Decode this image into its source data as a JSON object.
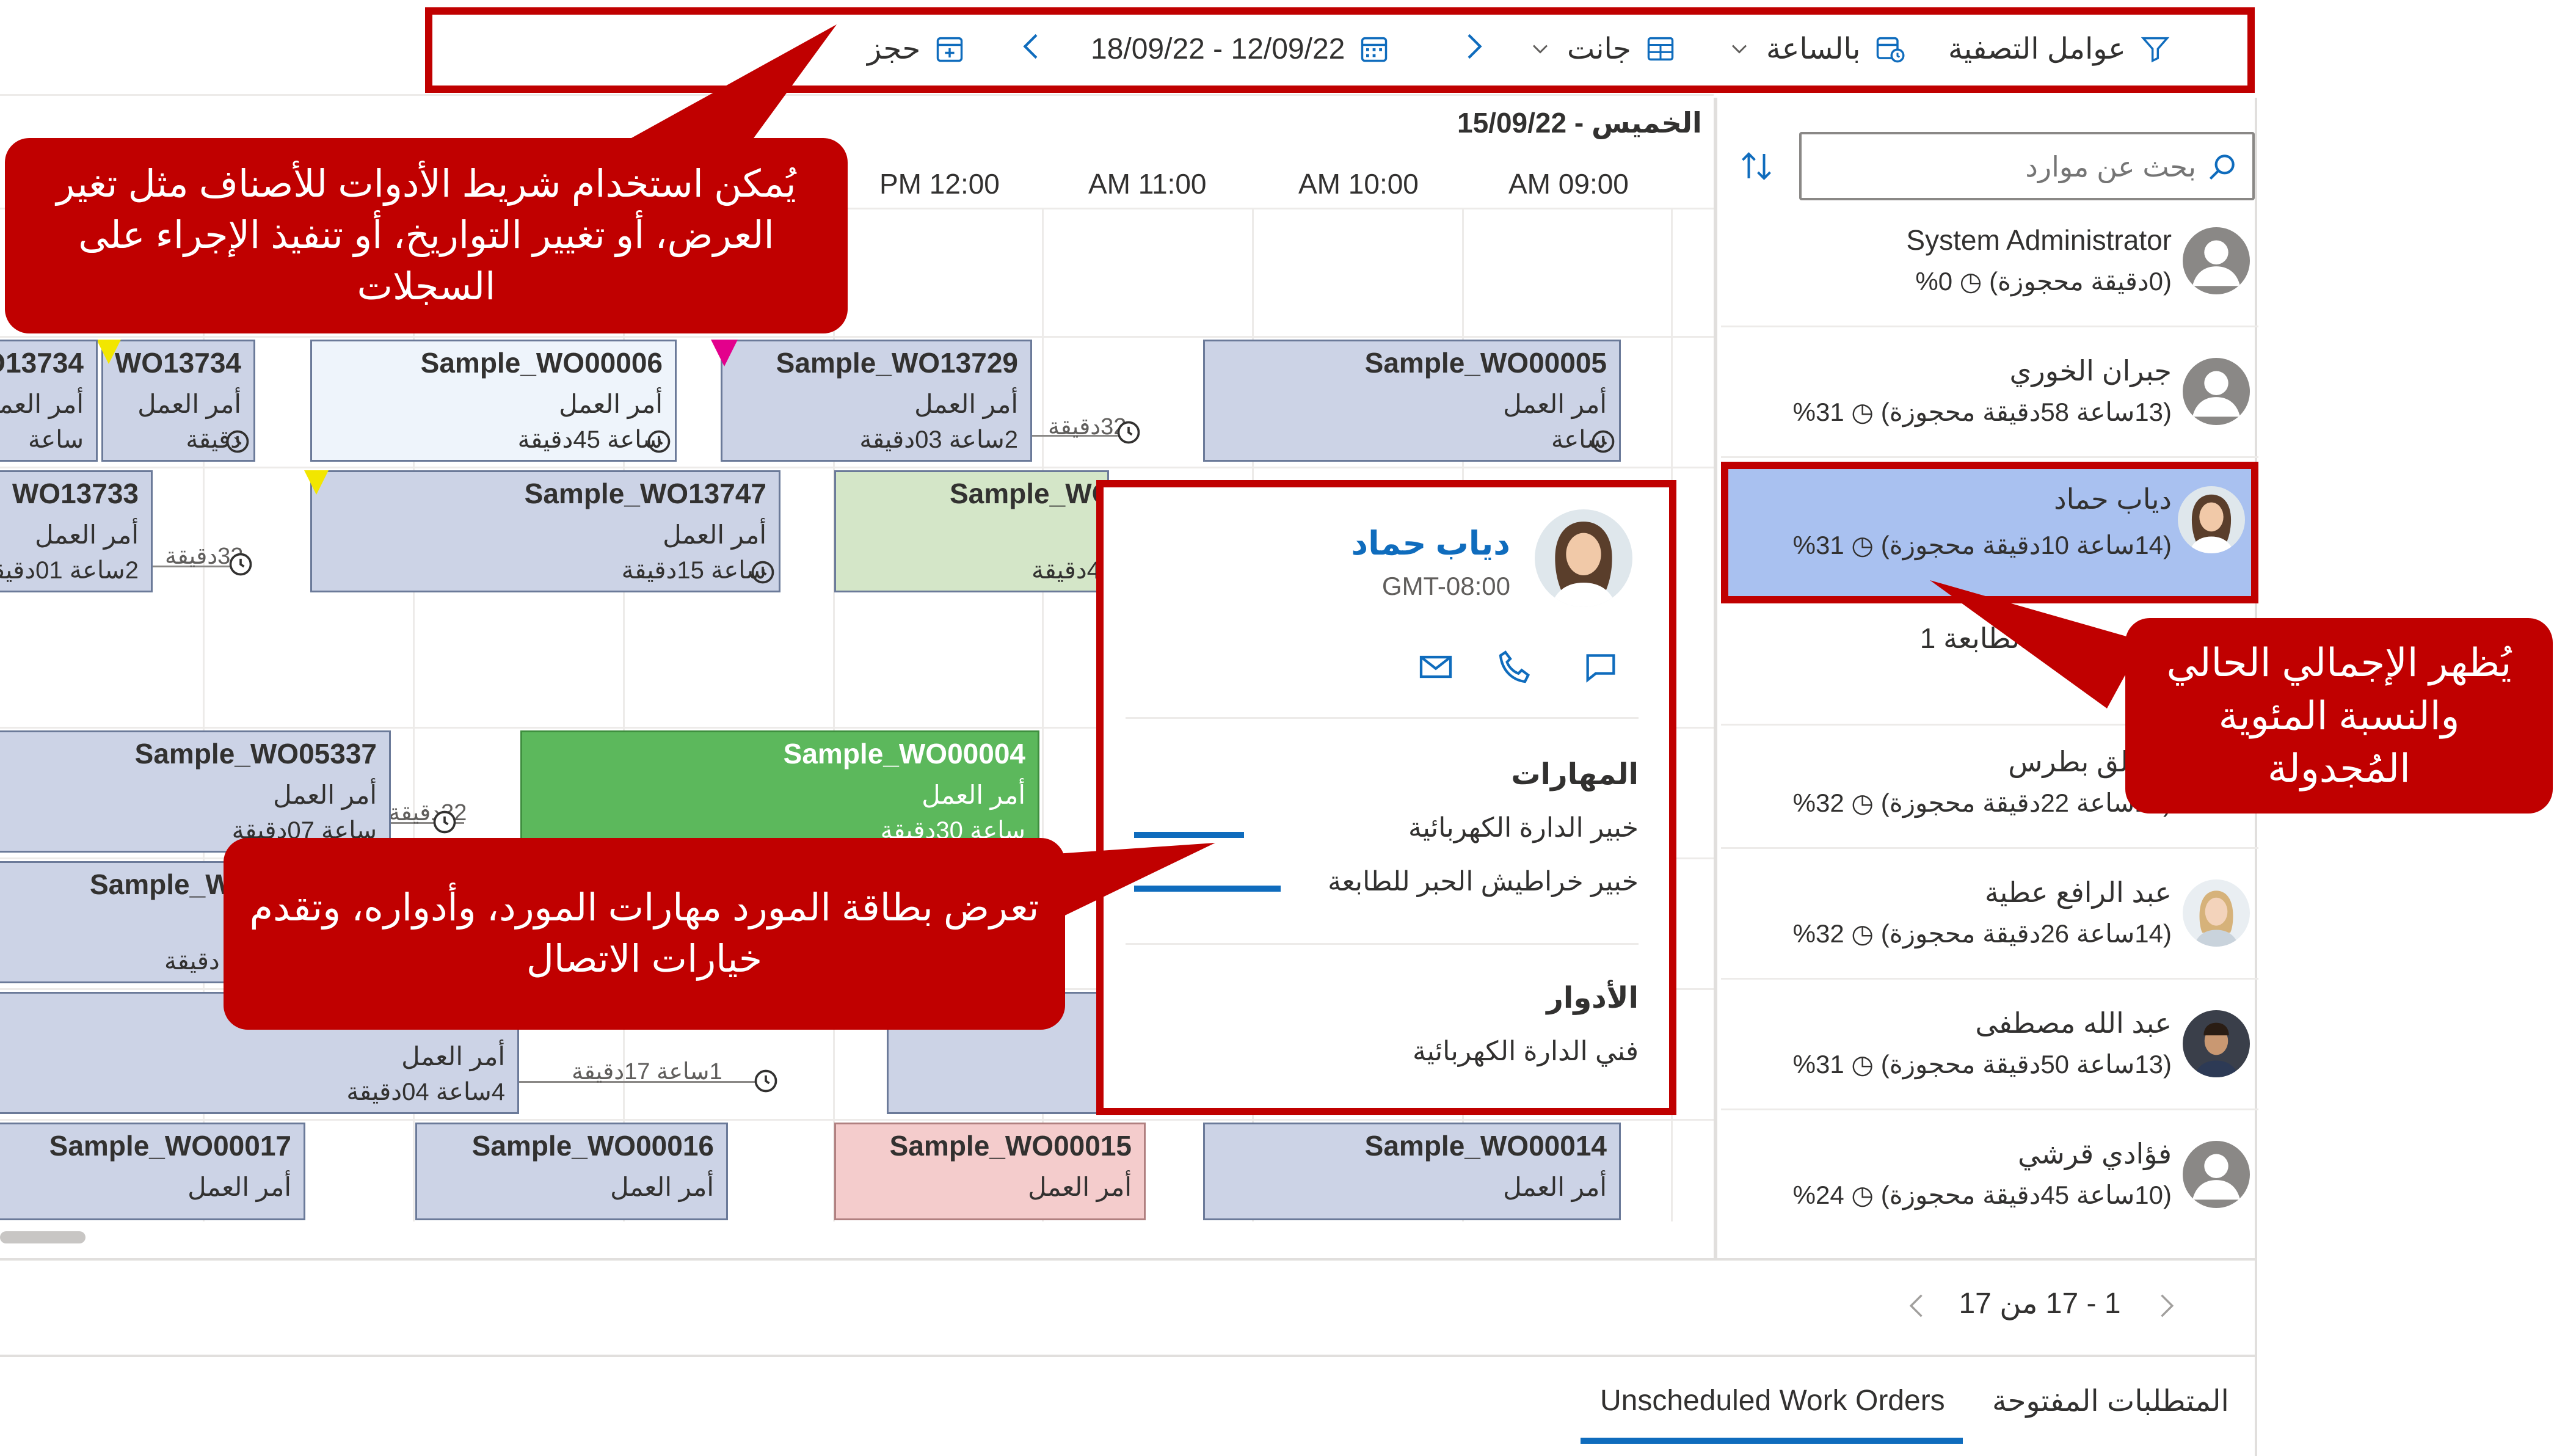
{
  "toolbar": {
    "filter_label": "عوامل التصفية",
    "view_label": "بالساعة",
    "layout_label": "جانت",
    "date_range": "18/09/22 - 12/09/22",
    "book_label": "حجز"
  },
  "search": {
    "placeholder": "بحث عن موارد"
  },
  "timeline": {
    "day_label": "الخميس - 15/09/22",
    "hours": [
      "AM 09:00",
      "AM 10:00",
      "AM 11:00",
      "PM 12:00"
    ]
  },
  "resources": [
    {
      "name": "System Administrator",
      "stats": "(0دقيقة محجوزة)",
      "pct": "0%"
    },
    {
      "name": "جبران الخوري",
      "stats": "(13ساعة 58دقيقة محجوزة)",
      "pct": "31%"
    },
    {
      "name": "دياب حماد",
      "stats": "(14ساعة 10دقيقة محجوزة)",
      "pct": "31%"
    },
    {
      "name": "...قم تركيب الطابعة 1",
      "stats": "",
      "pct": ""
    },
    {
      "name": "الخالق بطرس",
      "stats": "(13ساعة 22دقيقة محجوزة)",
      "pct": "32%"
    },
    {
      "name": "عبد الرافع عطية",
      "stats": "(14ساعة 26دقيقة محجوزة)",
      "pct": "32%"
    },
    {
      "name": "عبد الله مصطفى",
      "stats": "(13ساعة 50دقيقة محجوزة)",
      "pct": "31%"
    },
    {
      "name": "فؤادي قرشي",
      "stats": "(10ساعة 45دقيقة محجوزة)",
      "pct": "24%"
    }
  ],
  "pagination": {
    "label": "1 - 17 من 17"
  },
  "bottom_tabs": {
    "open_requirements": "المتطلبات المفتوحة",
    "unscheduled": "Unscheduled Work Orders"
  },
  "bookings": {
    "b1": {
      "title": "Sample_WO00005",
      "type": "أمر العمل",
      "dur": "ساعة"
    },
    "b2": {
      "title": "Sample_WO13729",
      "type": "أمر العمل",
      "dur": "2ساعة 03دقيقة"
    },
    "b3": {
      "title": "Sample_WO00006",
      "type": "أمر العمل",
      "dur": "ساعة 45دقيقة"
    },
    "b4": {
      "title": "WO13734",
      "type": "أمر العمل",
      "dur": "دقيقة"
    },
    "b5": {
      "title": "O13734",
      "type": "أمر العمل",
      "dur": "ساعة"
    },
    "b6": {
      "title": "Sample_WO",
      "type": "",
      "dur": "4دقيقة"
    },
    "b7": {
      "title": "Sample_WO13747",
      "type": "أمر العمل",
      "dur": "ساعة 15دقيقة"
    },
    "b8": {
      "title": "WO13733",
      "type": "أمر العمل",
      "dur": "2ساعة 01دقيقة"
    },
    "b9": {
      "title": "Sample_WO00004",
      "type": "أمر العمل",
      "dur": "ساعة 30دقيقة"
    },
    "b10": {
      "title": "Sample_WO05337",
      "type": "أمر العمل",
      "dur": "ساعة 07دقيقة"
    },
    "b11": {
      "title": "Sample_W",
      "type": "",
      "dur": "دقيقة"
    },
    "b12": {
      "title": "",
      "type": "أمر العمل",
      "dur": "4ساعة 04دقيقة"
    },
    "b13": {
      "title": "Sample_WO00014",
      "type": "أمر العمل",
      "dur": ""
    },
    "b14": {
      "title": "Sample_WO00015",
      "type": "أمر العمل",
      "dur": ""
    },
    "b15": {
      "title": "Sample_WO00016",
      "type": "أمر العمل",
      "dur": ""
    },
    "b16": {
      "title": "Sample_WO00017",
      "type": "أمر العمل",
      "dur": ""
    }
  },
  "travel": {
    "t1": "32دقيقة",
    "t2": "32دقيقة",
    "t3": "32دقيقة",
    "t4": "1ساعة 17دقيقة"
  },
  "card": {
    "name": "دياب حماد",
    "timezone": "GMT-08:00",
    "skills_heading": "المهارات",
    "skills": [
      "خبير الدارة الكهربائية",
      "خبير خراطيش الحبر للطابعة"
    ],
    "roles_heading": "الأدوار",
    "roles": [
      "فني الدارة الكهربائية"
    ]
  },
  "callouts": {
    "toolbar_note": "يُمكن استخدام شريط الأدوات للأصناف مثل تغير العرض، أو تغيير التواريخ، أو تنفيذ الإجراء على السجلات",
    "totals_note": "يُظهر الإجمالي الحالي والنسبة المئوية المُجدولة",
    "card_note": "تعرض بطاقة المورد مهارات المورد، وأدواره، وتقدم خيارات الاتصال"
  },
  "colors": {
    "accent": "#0f6cbd",
    "callout_red": "#c00000",
    "booking_default": "#ccd3e6",
    "booking_selected_green": "#5cb85c",
    "booking_light_green": "#d4e6c8",
    "booking_pink": "#f4cccc",
    "booking_white": "#eef4fb",
    "selected_resource": "#a9c1f0"
  }
}
